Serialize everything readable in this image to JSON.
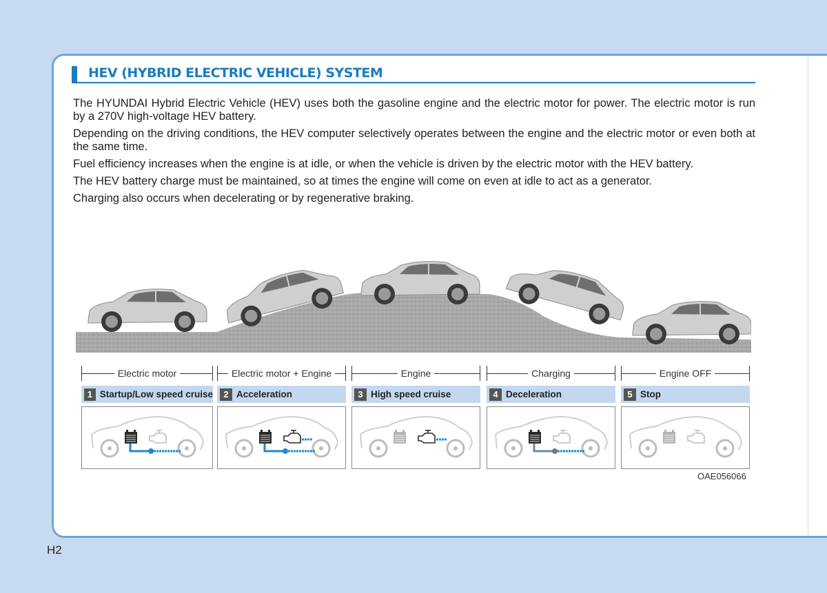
{
  "section": {
    "title": "HEV (HYBRID ELECTRIC VEHICLE) SYSTEM",
    "accent_color": "#1a7cc1"
  },
  "paragraphs": [
    "The HYUNDAI Hybrid Electric Vehicle (HEV) uses both the gasoline engine and the electric motor for power. The electric motor is run by a 270V high-voltage HEV battery.",
    "Depending on the driving conditions, the HEV computer selectively operates between the engine and the electric motor or even both at the same time.",
    "Fuel efficiency increases when the engine is at idle, or when the vehicle is driven by the electric motor with the HEV battery.",
    "The HEV battery charge must be maintained, so at times the engine will come on even at idle to act as a generator.",
    "Charging also occurs when decelerating or by regenerative braking."
  ],
  "stages": [
    {
      "mode": "Electric motor",
      "number": "1",
      "name": "Startup/Low speed cruise",
      "battery_active": true,
      "engine_active": false,
      "flow": "battery-to-wheel"
    },
    {
      "mode": "Electric motor + Engine",
      "number": "2",
      "name": "Acceleration",
      "battery_active": true,
      "engine_active": true,
      "flow": "both-to-wheel"
    },
    {
      "mode": "Engine",
      "number": "3",
      "name": "High speed cruise",
      "battery_active": false,
      "engine_active": true,
      "flow": "engine-to-wheel"
    },
    {
      "mode": "Charging",
      "number": "4",
      "name": "Deceleration",
      "battery_active": true,
      "engine_active": false,
      "flow": "wheel-to-battery"
    },
    {
      "mode": "Engine OFF",
      "number": "5",
      "name": "Stop",
      "battery_active": false,
      "engine_active": false,
      "flow": "none"
    }
  ],
  "figure_code": "OAE056066",
  "page_number": "H2"
}
